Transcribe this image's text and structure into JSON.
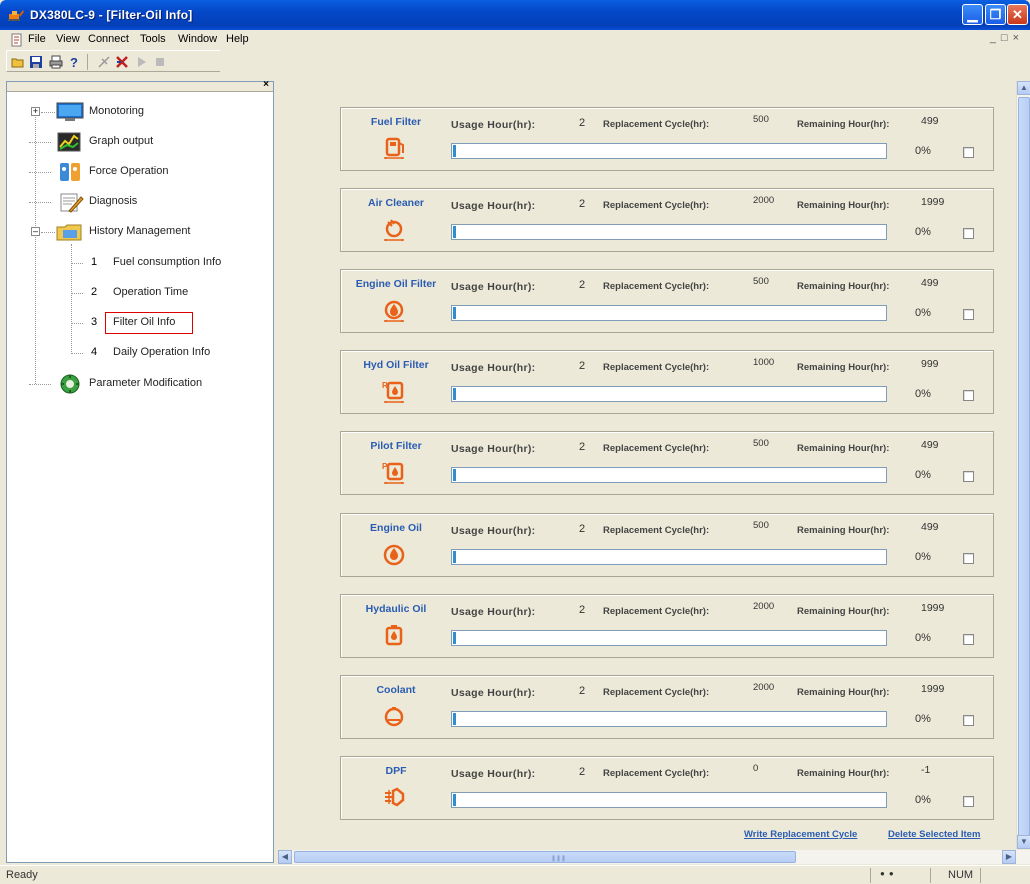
{
  "window": {
    "title": "DX380LC-9 - [Filter-Oil Info]"
  },
  "menu": {
    "items": [
      "File",
      "View",
      "Connect",
      "Tools",
      "Window",
      "Help"
    ]
  },
  "toolbar": {
    "icons": [
      "open-folder-icon",
      "save-icon",
      "print-icon",
      "help-icon",
      "connect-icon",
      "disconnect-icon",
      "play-icon",
      "stop-icon"
    ]
  },
  "tree": {
    "items": [
      {
        "label": "Monotoring",
        "icon": "monitor-icon"
      },
      {
        "label": "Graph output",
        "icon": "graph-icon"
      },
      {
        "label": "Force Operation",
        "icon": "tools-icon"
      },
      {
        "label": "Diagnosis",
        "icon": "diagnosis-icon"
      },
      {
        "label": "History Management",
        "icon": "folder-icon"
      },
      {
        "label": "Parameter Modification",
        "icon": "gear-globe-icon"
      }
    ],
    "sub_items": [
      {
        "num": "1",
        "label": "Fuel consumption Info"
      },
      {
        "num": "2",
        "label": "Operation Time"
      },
      {
        "num": "3",
        "label": "Filter Oil Info"
      },
      {
        "num": "4",
        "label": "Daily Operation Info"
      }
    ]
  },
  "labels": {
    "usage": "Usage Hour(hr):",
    "cycle": "Replacement Cycle(hr):",
    "remain": "Remaining Hour(hr):"
  },
  "filters": [
    {
      "name": "Fuel Filter",
      "icon": "fuel-filter-icon",
      "usage": "2",
      "cycle": "500",
      "remaining": "499",
      "percent": "0%",
      "progress": 0
    },
    {
      "name": "Air Cleaner",
      "icon": "air-cleaner-icon",
      "usage": "2",
      "cycle": "2000",
      "remaining": "1999",
      "percent": "0%",
      "progress": 0
    },
    {
      "name": "Engine Oil Filter",
      "icon": "engine-oil-filter-icon",
      "usage": "2",
      "cycle": "500",
      "remaining": "499",
      "percent": "0%",
      "progress": 0
    },
    {
      "name": "Hyd Oil Filter",
      "icon": "hyd-oil-filter-icon",
      "usage": "2",
      "cycle": "1000",
      "remaining": "999",
      "percent": "0%",
      "progress": 0
    },
    {
      "name": "Pilot Filter",
      "icon": "pilot-filter-icon",
      "usage": "2",
      "cycle": "500",
      "remaining": "499",
      "percent": "0%",
      "progress": 0
    },
    {
      "name": "Engine Oil",
      "icon": "engine-oil-icon",
      "usage": "2",
      "cycle": "500",
      "remaining": "499",
      "percent": "0%",
      "progress": 0
    },
    {
      "name": "Hydaulic Oil",
      "icon": "hydraulic-oil-icon",
      "usage": "2",
      "cycle": "2000",
      "remaining": "1999",
      "percent": "0%",
      "progress": 0
    },
    {
      "name": "Coolant",
      "icon": "coolant-icon",
      "usage": "2",
      "cycle": "2000",
      "remaining": "1999",
      "percent": "0%",
      "progress": 0
    },
    {
      "name": "DPF",
      "icon": "dpf-icon",
      "usage": "2",
      "cycle": "0",
      "remaining": "-1",
      "percent": "0%",
      "progress": 0
    }
  ],
  "actions": {
    "write": "Write Replacement Cycle",
    "delete": "Delete Selected Item"
  },
  "status": {
    "ready": "Ready",
    "num": "NUM"
  },
  "colors": {
    "accent_orange": "#e8621a",
    "label_blue": "#2a5cb4",
    "progress_fill": "#2e8ecf",
    "selected_border": "#dd0000"
  }
}
